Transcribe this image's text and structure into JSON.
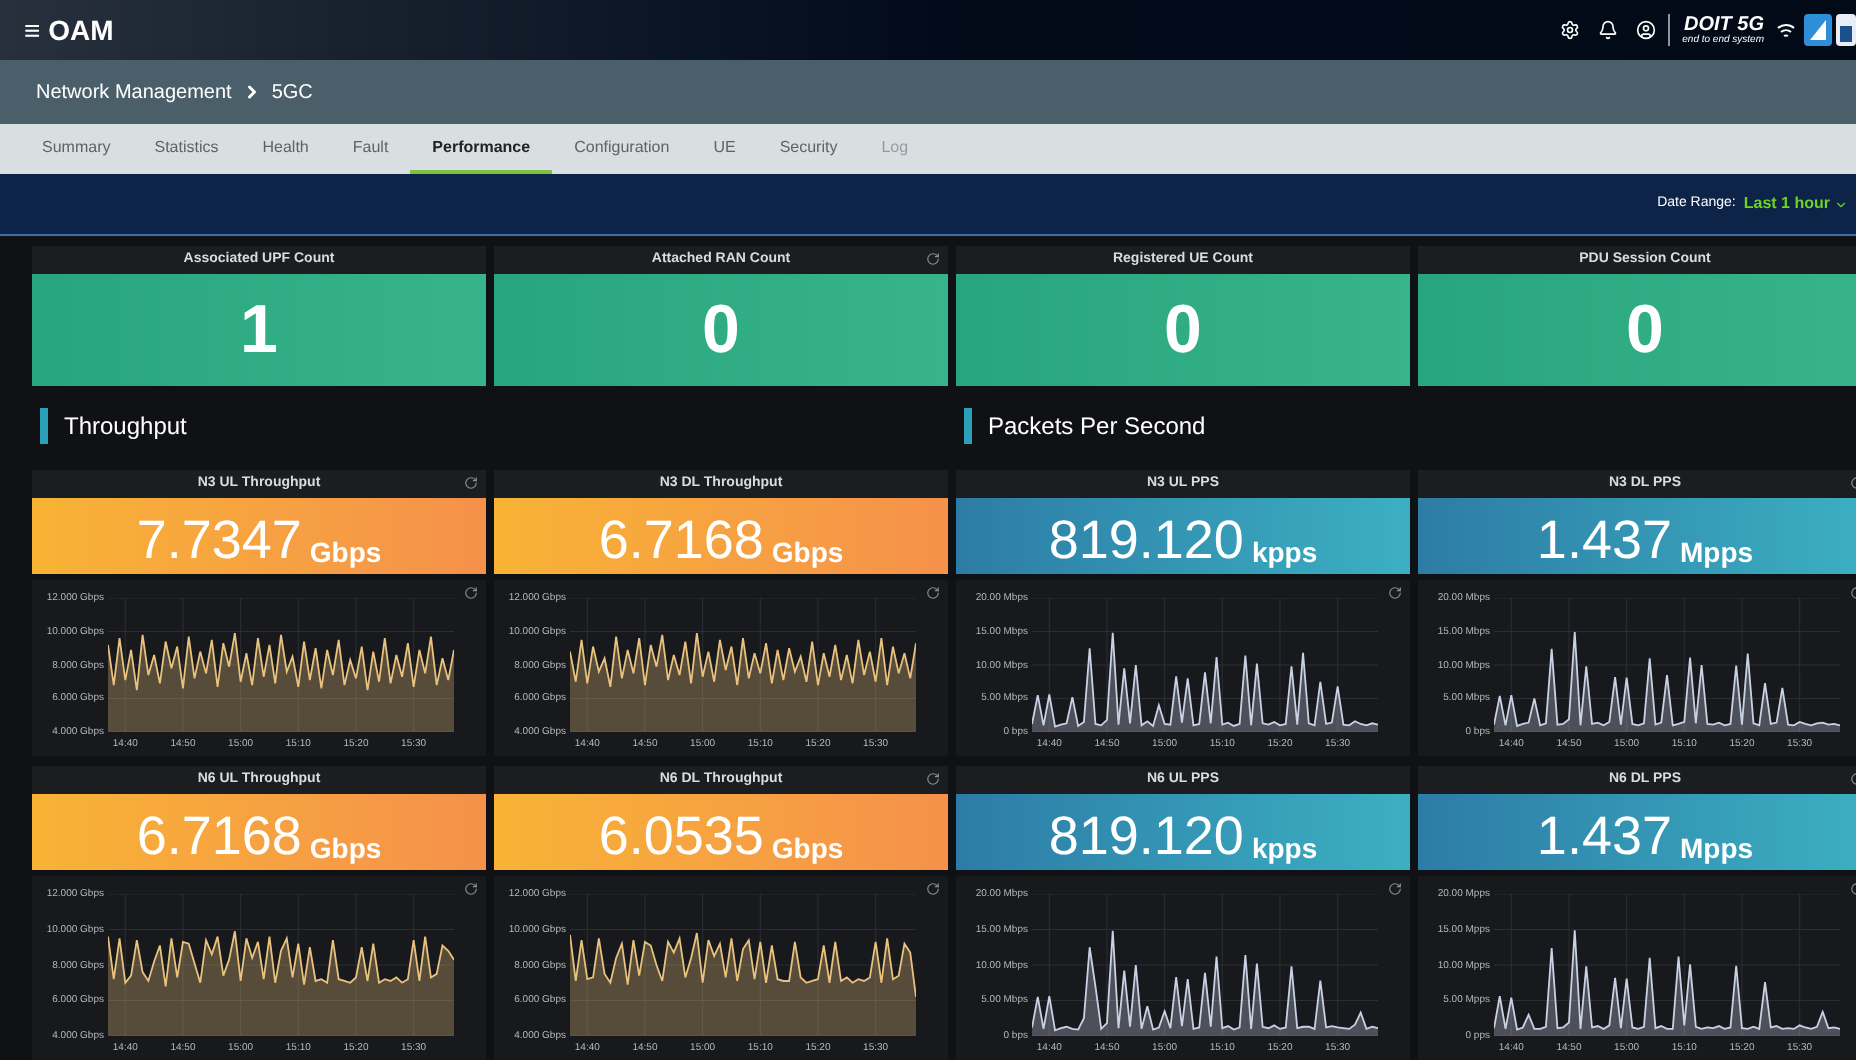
{
  "app": {
    "menu_glyph": "≡",
    "title": "OAM"
  },
  "logo": {
    "name": "DOIT 5G",
    "tagline": "end to end system"
  },
  "breadcrumb": [
    {
      "label": "Network Management"
    },
    {
      "label": "5GC"
    }
  ],
  "tabs": [
    {
      "label": "Summary",
      "selected": false,
      "disabled": false
    },
    {
      "label": "Statistics",
      "selected": false,
      "disabled": false
    },
    {
      "label": "Health",
      "selected": false,
      "disabled": false
    },
    {
      "label": "Fault",
      "selected": false,
      "disabled": false
    },
    {
      "label": "Performance",
      "selected": true,
      "disabled": false
    },
    {
      "label": "Configuration",
      "selected": false,
      "disabled": false
    },
    {
      "label": "UE",
      "selected": false,
      "disabled": false
    },
    {
      "label": "Security",
      "selected": false,
      "disabled": false
    },
    {
      "label": "Log",
      "selected": false,
      "disabled": true
    }
  ],
  "date_range": {
    "label": "Date Range:",
    "value": "Last 1 hour"
  },
  "stats": [
    {
      "title": "Associated UPF Count",
      "value": "1",
      "refresh": false
    },
    {
      "title": "Attached RAN Count",
      "value": "0",
      "refresh": true
    },
    {
      "title": "Registered UE Count",
      "value": "0",
      "refresh": false
    },
    {
      "title": "PDU Session Count",
      "value": "0",
      "refresh": false
    }
  ],
  "sections": [
    {
      "title": "Throughput"
    },
    {
      "title": "Packets Per Second"
    }
  ],
  "panels": [
    {
      "title": "N3 UL Throughput",
      "value": "7.7347",
      "unit": "Gbps",
      "kind": "throughput",
      "refresh": true,
      "chart_data": {
        "type": "area",
        "grid": true,
        "ylim": [
          4,
          12
        ],
        "categories": [
          null,
          null,
          null,
          "14:40",
          null,
          null,
          null,
          null,
          null,
          null,
          null,
          null,
          null,
          "14:50",
          null,
          null,
          null,
          null,
          null,
          null,
          null,
          null,
          null,
          "15:00",
          null,
          null,
          null,
          null,
          null,
          null,
          null,
          null,
          null,
          "15:10",
          null,
          null,
          null,
          null,
          null,
          null,
          null,
          null,
          null,
          "15:20",
          null,
          null,
          null,
          null,
          null,
          null,
          null,
          null,
          null,
          "15:30",
          null,
          null,
          null,
          null,
          null,
          null,
          null
        ],
        "yticks": [
          {
            "value": 12,
            "label": "12.000 Gbps"
          },
          {
            "value": 10,
            "label": "10.000 Gbps"
          },
          {
            "value": 8,
            "label": "8.000 Gbps"
          },
          {
            "value": 6,
            "label": "6.000 Gbps"
          },
          {
            "value": 4,
            "label": "4.000 Gbps"
          }
        ],
        "series": [
          {
            "color": "#e9c27e",
            "values": [
              9.2,
              6.8,
              9.6,
              7.1,
              8.9,
              6.5,
              9.8,
              7.4,
              8.6,
              6.9,
              9.4,
              7.8,
              9.1,
              6.6,
              9.7,
              7.2,
              8.8,
              7.5,
              9.5,
              6.7,
              9.3,
              7.9,
              9.9,
              7.0,
              8.7,
              6.8,
              9.6,
              7.3,
              9.2,
              6.9,
              9.8,
              7.6,
              8.5,
              6.7,
              9.4,
              7.1,
              9.0,
              6.6,
              8.9,
              7.4,
              9.5,
              6.8,
              8.3,
              7.2,
              9.1,
              6.5,
              8.8,
              7.0,
              9.6,
              6.9,
              8.6,
              7.3,
              9.3,
              6.7,
              8.9,
              7.5,
              9.7,
              6.8,
              8.4,
              7.1,
              8.9
            ]
          }
        ]
      }
    },
    {
      "title": "N3 DL Throughput",
      "value": "6.7168",
      "unit": "Gbps",
      "kind": "throughput",
      "refresh": false,
      "chart_data": {
        "type": "area",
        "grid": true,
        "ylim": [
          4,
          12
        ],
        "categories": [
          null,
          null,
          null,
          "14:40",
          null,
          null,
          null,
          null,
          null,
          null,
          null,
          null,
          null,
          "14:50",
          null,
          null,
          null,
          null,
          null,
          null,
          null,
          null,
          null,
          "15:00",
          null,
          null,
          null,
          null,
          null,
          null,
          null,
          null,
          null,
          "15:10",
          null,
          null,
          null,
          null,
          null,
          null,
          null,
          null,
          null,
          "15:20",
          null,
          null,
          null,
          null,
          null,
          null,
          null,
          null,
          null,
          "15:30",
          null,
          null,
          null,
          null,
          null,
          null,
          null
        ],
        "yticks": [
          {
            "value": 12,
            "label": "12.000 Gbps"
          },
          {
            "value": 10,
            "label": "10.000 Gbps"
          },
          {
            "value": 8,
            "label": "8.000 Gbps"
          },
          {
            "value": 6,
            "label": "6.000 Gbps"
          },
          {
            "value": 4,
            "label": "4.000 Gbps"
          }
        ],
        "series": [
          {
            "color": "#e9c27e",
            "values": [
              8.8,
              7.0,
              9.5,
              6.9,
              9.1,
              7.6,
              8.4,
              6.7,
              9.7,
              7.2,
              8.9,
              7.5,
              9.6,
              6.8,
              9.2,
              7.9,
              9.8,
              7.1,
              8.6,
              7.4,
              9.4,
              6.9,
              9.9,
              7.3,
              8.8,
              7.0,
              9.5,
              7.7,
              9.1,
              6.8,
              9.6,
              7.2,
              8.7,
              7.5,
              9.3,
              6.9,
              8.9,
              7.1,
              9.0,
              7.6,
              8.5,
              7.0,
              9.4,
              6.8,
              8.7,
              7.3,
              9.2,
              7.1,
              8.6,
              6.9,
              9.5,
              7.4,
              8.8,
              7.0,
              9.6,
              6.8,
              9.1,
              7.5,
              8.7,
              7.2,
              9.3
            ]
          }
        ]
      }
    },
    {
      "title": "N3 UL PPS",
      "value": "819.120",
      "unit": "kpps",
      "kind": "pps",
      "refresh": false,
      "chart_data": {
        "type": "area",
        "grid": true,
        "ylim": [
          0,
          20
        ],
        "categories": [
          null,
          null,
          null,
          "14:40",
          null,
          null,
          null,
          null,
          null,
          null,
          null,
          null,
          null,
          "14:50",
          null,
          null,
          null,
          null,
          null,
          null,
          null,
          null,
          null,
          "15:00",
          null,
          null,
          null,
          null,
          null,
          null,
          null,
          null,
          null,
          "15:10",
          null,
          null,
          null,
          null,
          null,
          null,
          null,
          null,
          null,
          "15:20",
          null,
          null,
          null,
          null,
          null,
          null,
          null,
          null,
          null,
          "15:30",
          null,
          null,
          null,
          null,
          null,
          null,
          null
        ],
        "yticks": [
          {
            "value": 20,
            "label": "20.00 Mbps"
          },
          {
            "value": 15,
            "label": "15.00 Mbps"
          },
          {
            "value": 10,
            "label": "10.00 Mbps"
          },
          {
            "value": 5,
            "label": "5.00 Mbps"
          },
          {
            "value": 0,
            "label": "0 bps"
          }
        ],
        "series": [
          {
            "color": "#c9d2e4",
            "values": [
              1.2,
              5.5,
              1.0,
              5.6,
              0.8,
              1.1,
              1.3,
              5.2,
              0.9,
              1.5,
              12.5,
              1.2,
              1.0,
              1.8,
              14.8,
              1.1,
              9.5,
              1.3,
              10.0,
              1.0,
              1.6,
              0.9,
              4.0,
              1.2,
              1.1,
              8.3,
              1.4,
              8.0,
              1.0,
              1.2,
              8.9,
              1.3,
              11.2,
              1.1,
              1.4,
              0.9,
              1.2,
              11.4,
              1.0,
              10.2,
              1.3,
              1.1,
              1.5,
              1.0,
              1.2,
              9.8,
              1.1,
              11.8,
              1.3,
              1.0,
              7.5,
              1.2,
              1.4,
              6.8,
              1.1,
              1.0,
              1.6,
              1.2,
              1.0,
              1.3,
              1.1
            ]
          }
        ]
      }
    },
    {
      "title": "N3 DL PPS",
      "value": "1.437",
      "unit": "Mpps",
      "kind": "pps",
      "refresh": true,
      "chart_data": {
        "type": "area",
        "grid": true,
        "ylim": [
          0,
          20
        ],
        "categories": [
          null,
          null,
          null,
          "14:40",
          null,
          null,
          null,
          null,
          null,
          null,
          null,
          null,
          null,
          "14:50",
          null,
          null,
          null,
          null,
          null,
          null,
          null,
          null,
          null,
          "15:00",
          null,
          null,
          null,
          null,
          null,
          null,
          null,
          null,
          null,
          "15:10",
          null,
          null,
          null,
          null,
          null,
          null,
          null,
          null,
          null,
          "15:20",
          null,
          null,
          null,
          null,
          null,
          null,
          null,
          null,
          null,
          "15:30",
          null,
          null,
          null,
          null,
          null,
          null,
          null
        ],
        "yticks": [
          {
            "value": 20,
            "label": "20.00 Mbps"
          },
          {
            "value": 15,
            "label": "15.00 Mbps"
          },
          {
            "value": 10,
            "label": "10.00 Mbps"
          },
          {
            "value": 5,
            "label": "5.00 Mbps"
          },
          {
            "value": 0,
            "label": "0 bps"
          }
        ],
        "series": [
          {
            "color": "#c9d2e4",
            "values": [
              1.1,
              5.4,
              1.0,
              5.5,
              0.9,
              1.2,
              1.4,
              5.0,
              1.0,
              1.3,
              12.4,
              1.1,
              1.2,
              1.9,
              14.9,
              1.0,
              9.8,
              1.2,
              1.4,
              1.0,
              1.5,
              8.2,
              1.1,
              8.1,
              1.2,
              1.0,
              1.3,
              11.0,
              1.1,
              1.4,
              8.5,
              1.0,
              1.2,
              1.5,
              11.1,
              1.3,
              10.0,
              1.2,
              1.1,
              1.4,
              1.0,
              1.2,
              9.9,
              1.1,
              11.7,
              1.3,
              1.0,
              7.3,
              1.2,
              1.4,
              6.6,
              1.1,
              1.0,
              1.5,
              1.2,
              1.0,
              1.3,
              1.4,
              1.1,
              1.2,
              1.0
            ]
          }
        ]
      }
    },
    {
      "title": "N6 UL Throughput",
      "value": "6.7168",
      "unit": "Gbps",
      "kind": "throughput",
      "refresh": false,
      "chart_data": {
        "type": "area",
        "grid": true,
        "ylim": [
          4,
          12
        ],
        "categories": [
          null,
          null,
          null,
          "14:40",
          null,
          null,
          null,
          null,
          null,
          null,
          null,
          null,
          null,
          "14:50",
          null,
          null,
          null,
          null,
          null,
          null,
          null,
          null,
          null,
          "15:00",
          null,
          null,
          null,
          null,
          null,
          null,
          null,
          null,
          null,
          "15:10",
          null,
          null,
          null,
          null,
          null,
          null,
          null,
          null,
          null,
          "15:20",
          null,
          null,
          null,
          null,
          null,
          null,
          null,
          null,
          null,
          "15:30",
          null,
          null,
          null,
          null,
          null,
          null,
          null
        ],
        "yticks": [
          {
            "value": 12,
            "label": "12.000 Gbps"
          },
          {
            "value": 10,
            "label": "10.000 Gbps"
          },
          {
            "value": 8,
            "label": "8.000 Gbps"
          },
          {
            "value": 6,
            "label": "6.000 Gbps"
          },
          {
            "value": 4,
            "label": "4.000 Gbps"
          }
        ],
        "series": [
          {
            "color": "#e9c27e",
            "values": [
              9.6,
              7.2,
              9.5,
              7.0,
              7.4,
              9.4,
              7.6,
              7.1,
              8.2,
              9.1,
              6.8,
              9.5,
              7.3,
              9.3,
              9.2,
              8.1,
              7.0,
              9.4,
              8.6,
              9.6,
              7.4,
              8.3,
              9.9,
              7.1,
              9.5,
              8.4,
              9.3,
              7.2,
              9.6,
              7.0,
              8.8,
              9.5,
              7.3,
              9.2,
              6.9,
              9.0,
              7.1,
              7.2,
              7.0,
              9.4,
              7.2,
              7.1,
              7.0,
              7.3,
              9.0,
              7.1,
              9.2,
              7.0,
              7.2,
              7.1,
              7.3,
              7.0,
              7.2,
              9.4,
              7.1,
              9.6,
              7.3,
              7.5,
              9.1,
              8.8,
              8.3
            ]
          }
        ]
      }
    },
    {
      "title": "N6 DL Throughput",
      "value": "6.0535",
      "unit": "Gbps",
      "kind": "throughput",
      "refresh": true,
      "chart_data": {
        "type": "area",
        "grid": true,
        "ylim": [
          4,
          12
        ],
        "categories": [
          null,
          null,
          null,
          "14:40",
          null,
          null,
          null,
          null,
          null,
          null,
          null,
          null,
          null,
          "14:50",
          null,
          null,
          null,
          null,
          null,
          null,
          null,
          null,
          null,
          "15:00",
          null,
          null,
          null,
          null,
          null,
          null,
          null,
          null,
          null,
          "15:10",
          null,
          null,
          null,
          null,
          null,
          null,
          null,
          null,
          null,
          "15:20",
          null,
          null,
          null,
          null,
          null,
          null,
          null,
          null,
          null,
          "15:30",
          null,
          null,
          null,
          null,
          null,
          null,
          null
        ],
        "yticks": [
          {
            "value": 12,
            "label": "12.000 Gbps"
          },
          {
            "value": 10,
            "label": "10.000 Gbps"
          },
          {
            "value": 8,
            "label": "8.000 Gbps"
          },
          {
            "value": 6,
            "label": "6.000 Gbps"
          },
          {
            "value": 4,
            "label": "4.000 Gbps"
          }
        ],
        "series": [
          {
            "color": "#e9c27e",
            "values": [
              9.7,
              7.1,
              9.4,
              7.2,
              7.3,
              9.5,
              7.5,
              7.0,
              8.4,
              9.2,
              6.9,
              9.4,
              7.4,
              9.3,
              9.1,
              8.0,
              7.1,
              9.3,
              8.7,
              9.5,
              7.3,
              8.4,
              9.8,
              7.0,
              9.4,
              8.5,
              9.2,
              7.3,
              9.5,
              7.1,
              8.9,
              9.4,
              7.2,
              9.3,
              7.0,
              9.1,
              7.2,
              7.1,
              7.1,
              9.3,
              7.3,
              7.0,
              7.1,
              7.2,
              9.1,
              7.0,
              9.3,
              7.1,
              7.3,
              7.0,
              7.2,
              7.1,
              7.3,
              9.3,
              7.0,
              9.5,
              7.2,
              7.4,
              9.2,
              8.7,
              6.2
            ]
          }
        ]
      }
    },
    {
      "title": "N6 UL PPS",
      "value": "819.120",
      "unit": "kpps",
      "kind": "pps",
      "refresh": false,
      "chart_data": {
        "type": "area",
        "grid": true,
        "ylim": [
          0,
          20
        ],
        "categories": [
          null,
          null,
          null,
          "14:40",
          null,
          null,
          null,
          null,
          null,
          null,
          null,
          null,
          null,
          "14:50",
          null,
          null,
          null,
          null,
          null,
          null,
          null,
          null,
          null,
          "15:00",
          null,
          null,
          null,
          null,
          null,
          null,
          null,
          null,
          null,
          "15:10",
          null,
          null,
          null,
          null,
          null,
          null,
          null,
          null,
          null,
          "15:20",
          null,
          null,
          null,
          null,
          null,
          null,
          null,
          null,
          null,
          "15:30",
          null,
          null,
          null,
          null,
          null,
          null,
          null
        ],
        "yticks": [
          {
            "value": 20,
            "label": "20.00 Mbps"
          },
          {
            "value": 15,
            "label": "15.00 Mbps"
          },
          {
            "value": 10,
            "label": "10.00 Mbps"
          },
          {
            "value": 5,
            "label": "5.00 Mbps"
          },
          {
            "value": 0,
            "label": "0 bps"
          }
        ],
        "series": [
          {
            "color": "#c9d2e4",
            "values": [
              1.2,
              5.5,
              1.0,
              5.6,
              0.8,
              1.1,
              1.3,
              1.0,
              0.9,
              2.5,
              12.5,
              7.0,
              1.0,
              1.8,
              14.8,
              1.1,
              9.2,
              1.3,
              10.0,
              1.0,
              4.2,
              0.9,
              1.2,
              3.5,
              1.1,
              8.3,
              1.4,
              8.0,
              1.0,
              1.2,
              8.9,
              1.3,
              11.2,
              1.1,
              1.4,
              0.9,
              1.2,
              11.4,
              1.0,
              10.2,
              1.3,
              1.1,
              1.5,
              1.0,
              1.2,
              9.8,
              1.1,
              1.3,
              1.3,
              1.0,
              7.8,
              1.2,
              1.4,
              1.2,
              1.1,
              1.0,
              1.6,
              3.3,
              1.0,
              1.3,
              1.1
            ]
          }
        ]
      }
    },
    {
      "title": "N6 DL PPS",
      "value": "1.437",
      "unit": "Mpps",
      "kind": "pps",
      "refresh": true,
      "chart_data": {
        "type": "area",
        "grid": true,
        "ylim": [
          0,
          20
        ],
        "categories": [
          null,
          null,
          null,
          "14:40",
          null,
          null,
          null,
          null,
          null,
          null,
          null,
          null,
          null,
          "14:50",
          null,
          null,
          null,
          null,
          null,
          null,
          null,
          null,
          null,
          "15:00",
          null,
          null,
          null,
          null,
          null,
          null,
          null,
          null,
          null,
          "15:10",
          null,
          null,
          null,
          null,
          null,
          null,
          null,
          null,
          null,
          "15:20",
          null,
          null,
          null,
          null,
          null,
          null,
          null,
          null,
          null,
          "15:30",
          null,
          null,
          null,
          null,
          null,
          null,
          null
        ],
        "yticks": [
          {
            "value": 20,
            "label": "20.00 Mpps"
          },
          {
            "value": 15,
            "label": "15.00 Mpps"
          },
          {
            "value": 10,
            "label": "10.00 Mpps"
          },
          {
            "value": 5,
            "label": "5.00 Mpps"
          },
          {
            "value": 0,
            "label": "0 pps"
          }
        ],
        "series": [
          {
            "color": "#c9d2e4",
            "values": [
              1.1,
              5.6,
              1.0,
              5.4,
              0.9,
              1.2,
              3.0,
              1.0,
              1.0,
              1.3,
              12.4,
              1.1,
              1.2,
              1.9,
              14.9,
              1.0,
              9.8,
              1.2,
              1.4,
              1.0,
              1.5,
              8.2,
              1.1,
              8.1,
              1.2,
              1.0,
              1.3,
              11.0,
              1.1,
              1.4,
              1.0,
              1.0,
              11.2,
              1.5,
              10.1,
              1.3,
              1.0,
              1.2,
              1.1,
              1.4,
              1.0,
              1.2,
              9.9,
              1.1,
              1.0,
              1.3,
              1.0,
              7.6,
              1.2,
              1.4,
              1.0,
              1.1,
              1.0,
              1.5,
              1.2,
              1.0,
              1.3,
              3.4,
              1.1,
              1.2,
              1.0
            ]
          }
        ]
      }
    }
  ]
}
